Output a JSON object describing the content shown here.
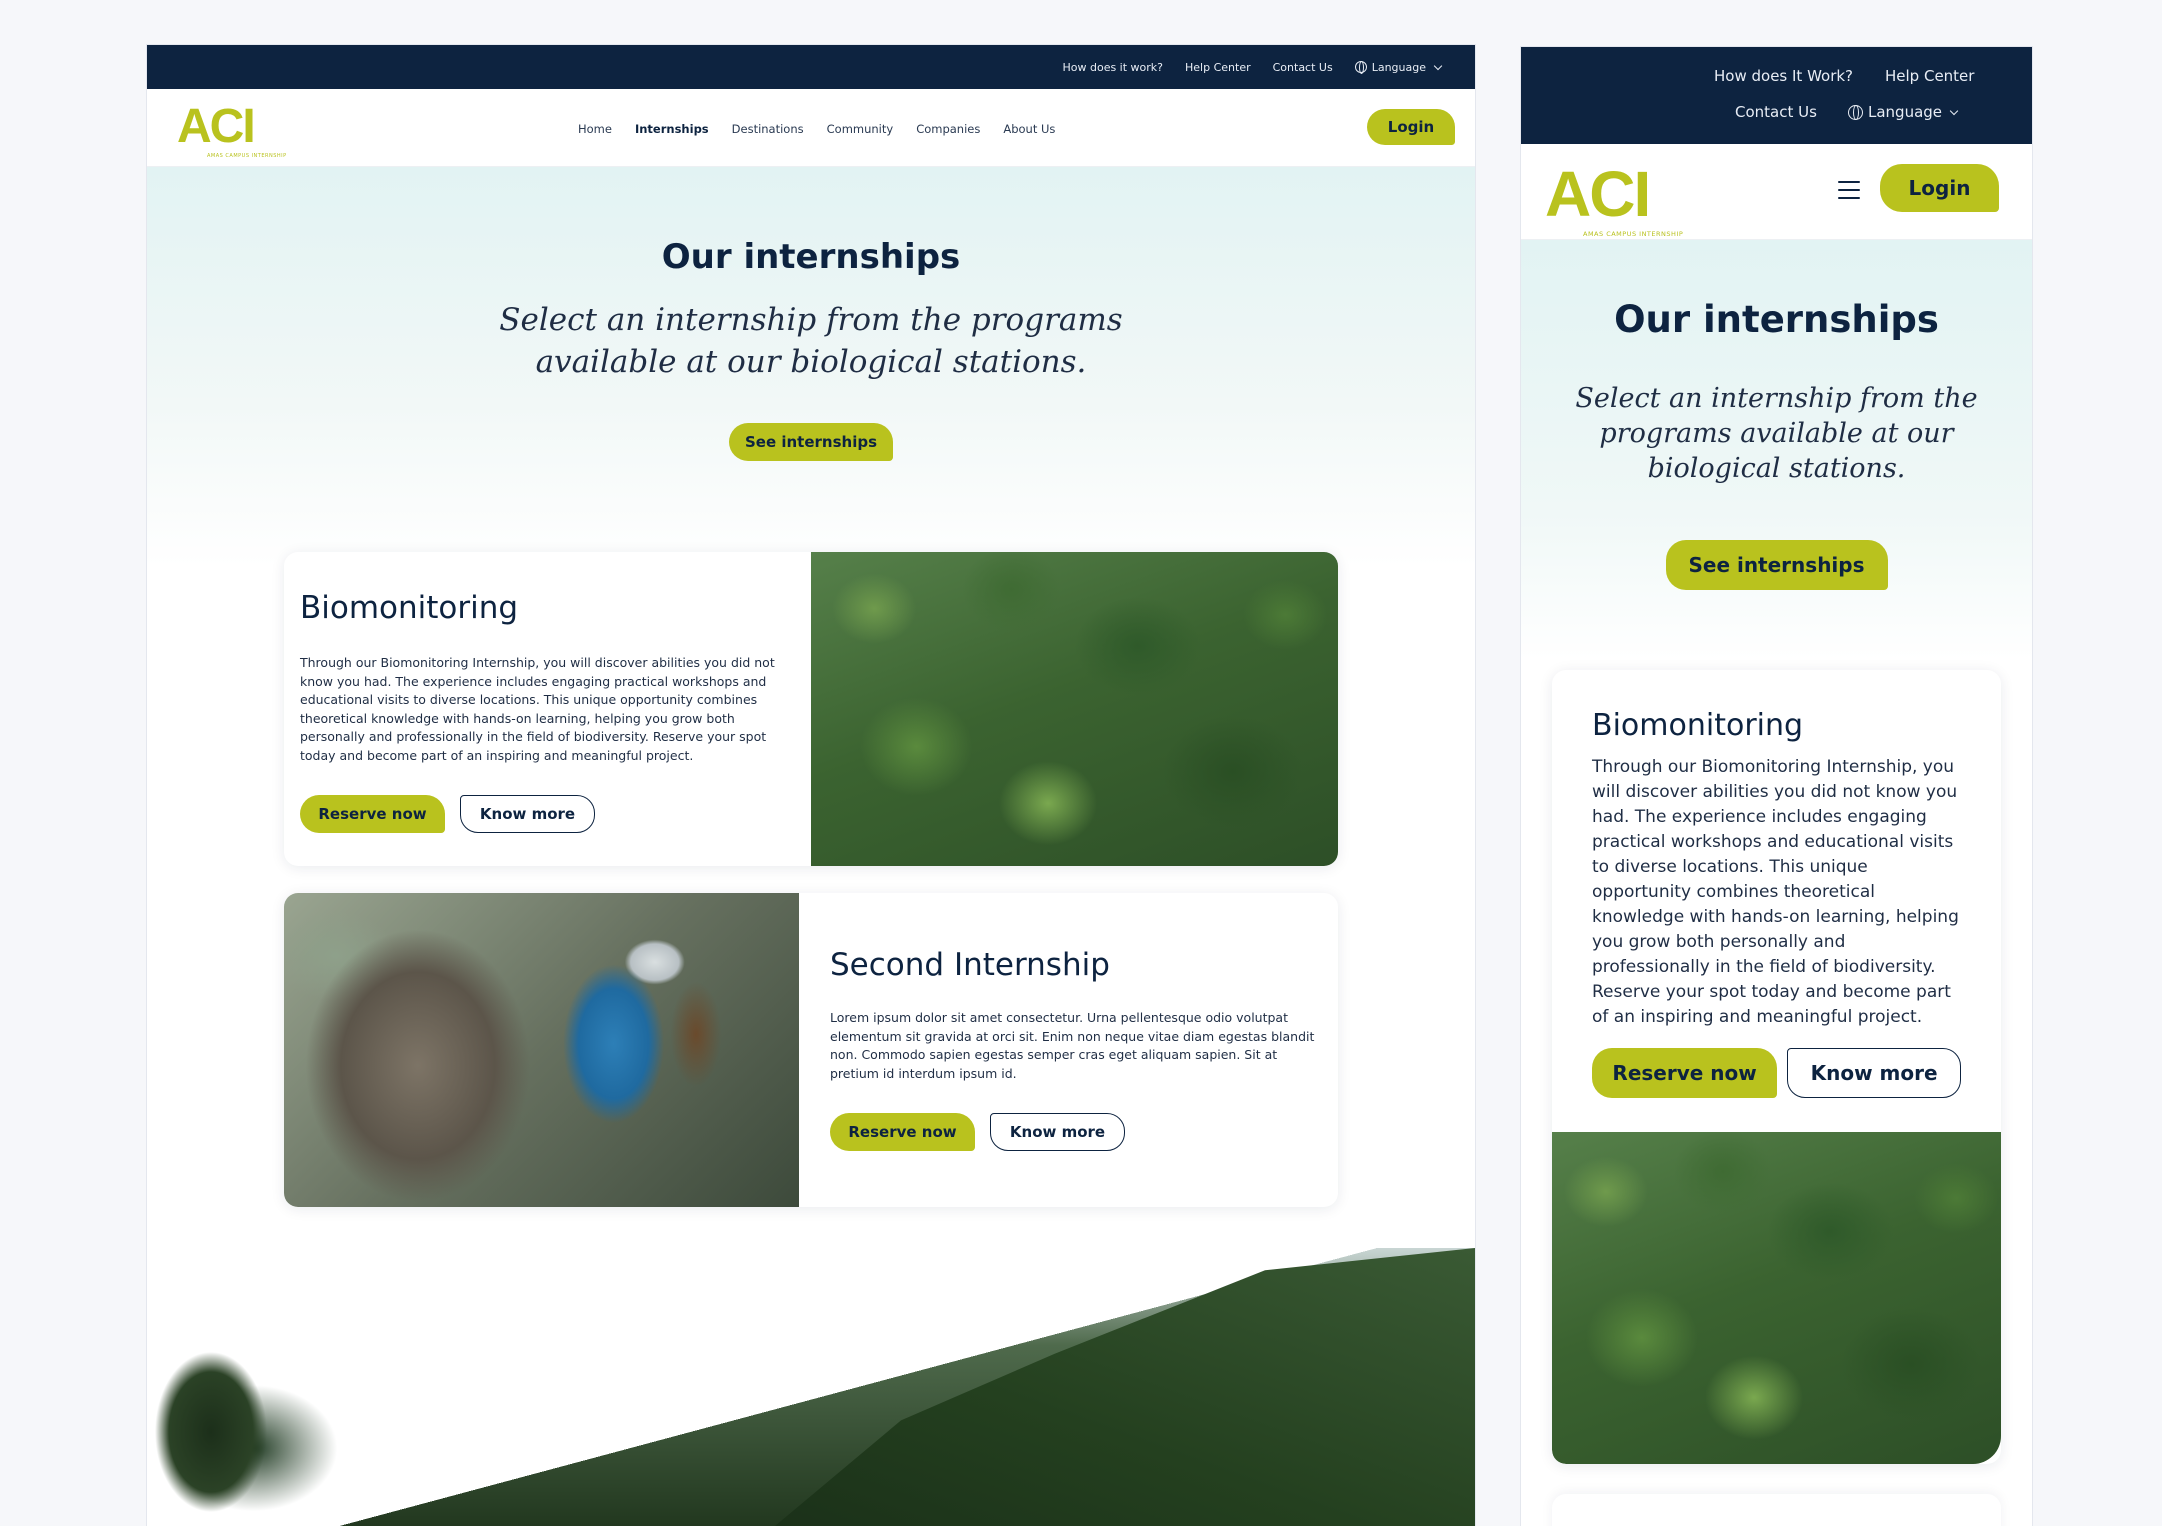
{
  "desktop": {
    "topbar": {
      "how": "How does it work?",
      "help": "Help Center",
      "contact": "Contact Us",
      "language": "Language"
    },
    "logo": {
      "mark": "ACI",
      "sub": "AMAS CAMPUS INTERNSHIP"
    },
    "nav": {
      "items": [
        "Home",
        "Internships",
        "Destinations",
        "Community",
        "Companies",
        "About Us"
      ],
      "active": "Internships",
      "login": "Login"
    },
    "hero": {
      "title": "Our internships",
      "subtitle_line1": "Select an internship from the programs",
      "subtitle_line2": "available at our biological stations.",
      "button": "See internships"
    },
    "cards": [
      {
        "title": "Biomonitoring",
        "body": "Through our Biomonitoring Internship, you will discover abilities you did not know you had. The experience includes engaging practical workshops and educational visits to diverse locations. This unique opportunity combines theoretical knowledge with hands-on learning, helping you grow both personally and professionally in the field of biodiversity. Reserve your spot today and become part of an inspiring and meaningful project.",
        "reserve": "Reserve now",
        "more": "Know more"
      },
      {
        "title": "Second Internship",
        "body": "Lorem ipsum dolor sit amet consectetur. Urna pellentesque odio volutpat elementum sit gravida at orci sit. Enim non neque vitae diam egestas blandit non. Commodo sapien egestas semper cras eget aliquam sapien. Sit at pretium id interdum ipsum id.",
        "reserve": "Reserve now",
        "more": "Know more"
      }
    ]
  },
  "mobile": {
    "topbar": {
      "how": "How does It Work?",
      "help": "Help Center",
      "contact": "Contact Us",
      "language": "Language"
    },
    "logo": {
      "mark": "ACI",
      "sub": "AMAS CAMPUS INTERNSHIP"
    },
    "login": "Login",
    "hero": {
      "title": "Our internships",
      "subtitle": "Select an internship from the programs available at our biological stations.",
      "button": "See internships"
    },
    "card": {
      "title": "Biomonitoring",
      "body": "Through our Biomonitoring Internship, you will discover abilities you did not know you had. The experience includes engaging practical workshops and educational visits to diverse locations. This unique opportunity combines theoretical knowledge with hands-on learning, helping you grow both personally and professionally in the field of biodiversity. Reserve your spot today and become part of an inspiring and meaningful project.",
      "reserve": "Reserve now",
      "more": "Know more"
    }
  },
  "colors": {
    "navy": "#0d2340",
    "lime": "#b9c21e",
    "hero_tint": "#e2f3f3"
  }
}
